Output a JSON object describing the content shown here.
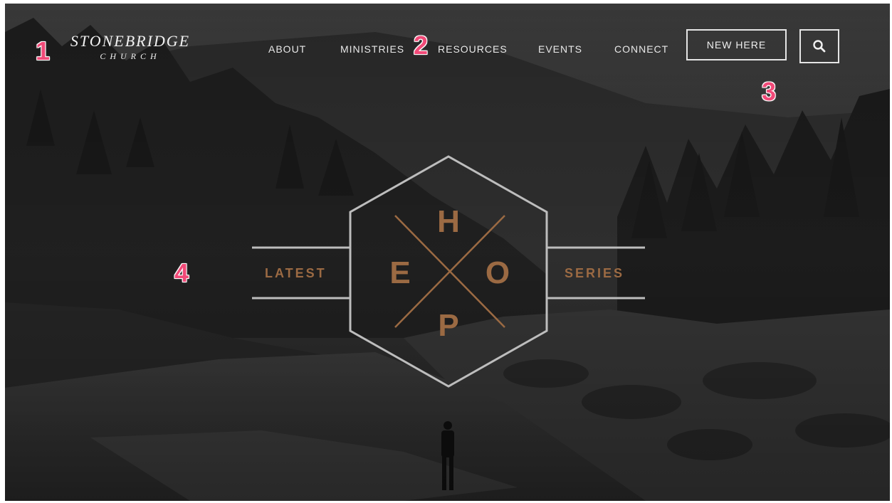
{
  "logo": {
    "name": "STONEBRIDGE",
    "sub": "CHURCH"
  },
  "nav": {
    "items": [
      {
        "label": "ABOUT"
      },
      {
        "label": "MINISTRIES"
      },
      {
        "label": "RESOURCES"
      },
      {
        "label": "EVENTS"
      },
      {
        "label": "CONNECT"
      }
    ],
    "new_here_label": "NEW HERE",
    "search_icon": "search-icon"
  },
  "hero": {
    "left_word": "LATEST",
    "right_word": "SERIES",
    "letters": {
      "top": "H",
      "left": "E",
      "right": "O",
      "bottom": "P"
    }
  },
  "markers": [
    "1",
    "2",
    "3",
    "4"
  ],
  "colors": {
    "accent": "#9b6a43",
    "marker": "#f14a78",
    "text": "#e8e8e8"
  }
}
